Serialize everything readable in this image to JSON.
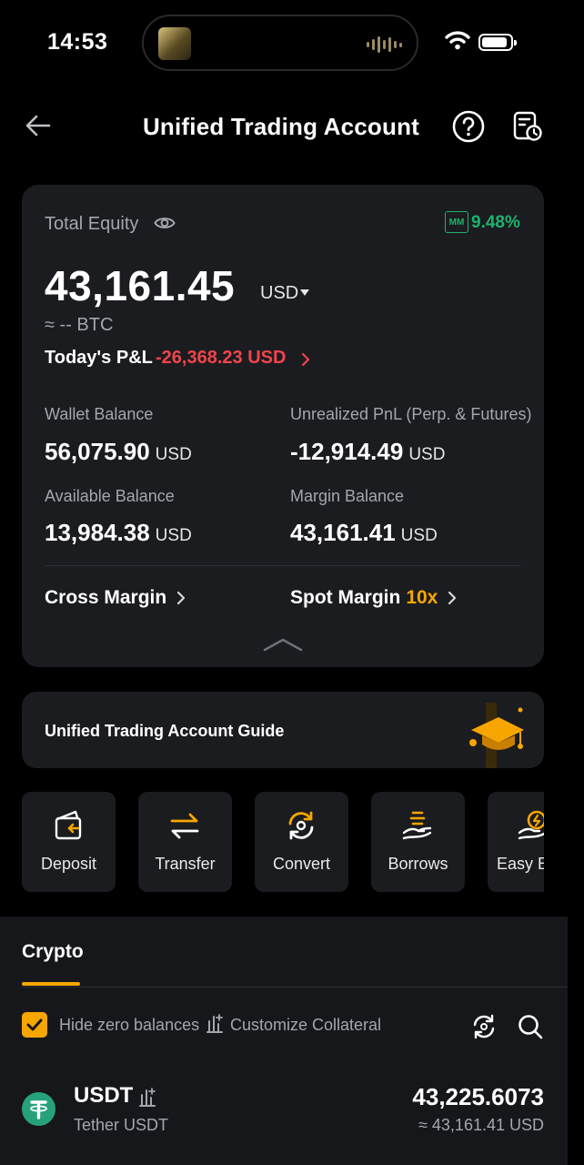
{
  "status_bar": {
    "time": "14:53"
  },
  "header": {
    "title": "Unified Trading Account"
  },
  "equity": {
    "label": "Total Equity",
    "mm_badge": "MM",
    "mm_ratio": "9.48%",
    "value": "43,161.45",
    "unit": "USD",
    "btc_approx": "≈ -- BTC",
    "pnl_label": "Today's P&L",
    "pnl_value": "-26,368.23 USD"
  },
  "balances": {
    "wallet_label": "Wallet Balance",
    "wallet_value": "56,075.90",
    "unrealized_label": "Unrealized PnL (Perp. & Futures)",
    "unrealized_value": "-12,914.49",
    "available_label": "Available Balance",
    "available_value": "13,984.38",
    "margin_label": "Margin Balance",
    "margin_value": "43,161.41",
    "unit": "USD"
  },
  "margin_modes": {
    "cross": "Cross Margin",
    "spot": "Spot Margin",
    "spot_leverage": "10x"
  },
  "guide": {
    "text": "Unified Trading Account Guide"
  },
  "actions": [
    {
      "label": "Deposit",
      "icon": "deposit-icon"
    },
    {
      "label": "Transfer",
      "icon": "transfer-icon"
    },
    {
      "label": "Convert",
      "icon": "convert-icon"
    },
    {
      "label": "Borrows",
      "icon": "borrows-icon"
    },
    {
      "label": "Easy Earn",
      "icon": "earn-icon"
    }
  ],
  "assets": {
    "tab": "Crypto",
    "hide_zero_label": "Hide zero balances",
    "hide_zero_checked": true,
    "customize_label": "Customize Collateral",
    "rows": [
      {
        "symbol": "USDT",
        "name": "Tether USDT",
        "amount": "43,225.6073",
        "usd_value": "≈ 43,161.41 USD"
      }
    ]
  },
  "colors": {
    "accent": "#f7a600",
    "positive": "#20b26c",
    "negative": "#f0454a",
    "card": "#1b1c20",
    "tether": "#26a17b"
  }
}
